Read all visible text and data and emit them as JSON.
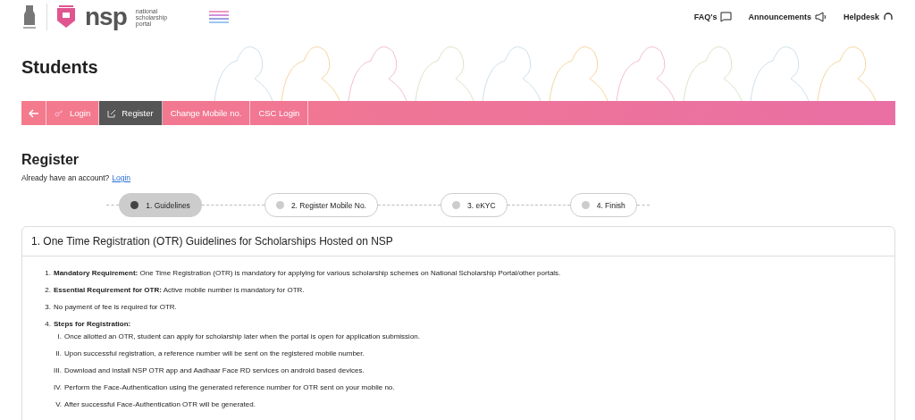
{
  "header": {
    "logo": {
      "short": "nsp",
      "long": [
        "national",
        "scholarship",
        "portal"
      ]
    },
    "links": [
      {
        "label": "FAQ's",
        "kind": "faq"
      },
      {
        "label": "Announcements",
        "kind": "announce"
      },
      {
        "label": "Helpdesk",
        "kind": "help"
      }
    ]
  },
  "hero": {
    "title": "Students"
  },
  "nav": [
    {
      "label": "Login",
      "kind": "login",
      "selected": false
    },
    {
      "label": "Register",
      "kind": "register",
      "selected": true
    },
    {
      "label": "Change Mobile no.",
      "kind": "plain",
      "selected": false
    },
    {
      "label": "CSC Login",
      "kind": "plain",
      "selected": false
    }
  ],
  "page": {
    "title": "Register",
    "prompt": "Already have an account?",
    "link": "Login"
  },
  "steps": [
    {
      "label": "1. Guidelines",
      "selected": true
    },
    {
      "label": "2. Register Mobile No.",
      "selected": false
    },
    {
      "label": "3. eKYC",
      "selected": false
    },
    {
      "label": "4. Finish",
      "selected": false
    }
  ],
  "card": {
    "title": "1. One Time Registration (OTR) Guidelines for Scholarships Hosted on NSP",
    "items": [
      {
        "num": "1.",
        "text": "**Mandatory Requirement:** One Time Registration (OTR) is mandatory for applying for various scholarship schemes on National Scholarship Portal/other portals."
      },
      {
        "num": "2.",
        "text": "**Essential Requirement for OTR:** Active mobile number is mandatory for OTR."
      },
      {
        "num": "3.",
        "text": "No payment of fee is required for OTR."
      },
      {
        "num": "4.",
        "text": "**Steps for Registration:**",
        "children": [
          {
            "num": "I.",
            "text": "Once allotted an OTR, student can apply for scholarship later when the portal is open for application submission."
          },
          {
            "num": "II.",
            "text": "Upon successful registration, a reference number will be sent on the registered mobile number."
          },
          {
            "num": "III.",
            "text": "Download and install NSP OTR app and Aadhaar Face RD services on android based devices."
          },
          {
            "num": "IV.",
            "text": "Perform the Face-Authentication using the generated reference number for OTR sent on your mobile no."
          },
          {
            "num": "V.",
            "text": "After successful Face-Authentication OTR will be generated."
          }
        ]
      }
    ]
  }
}
